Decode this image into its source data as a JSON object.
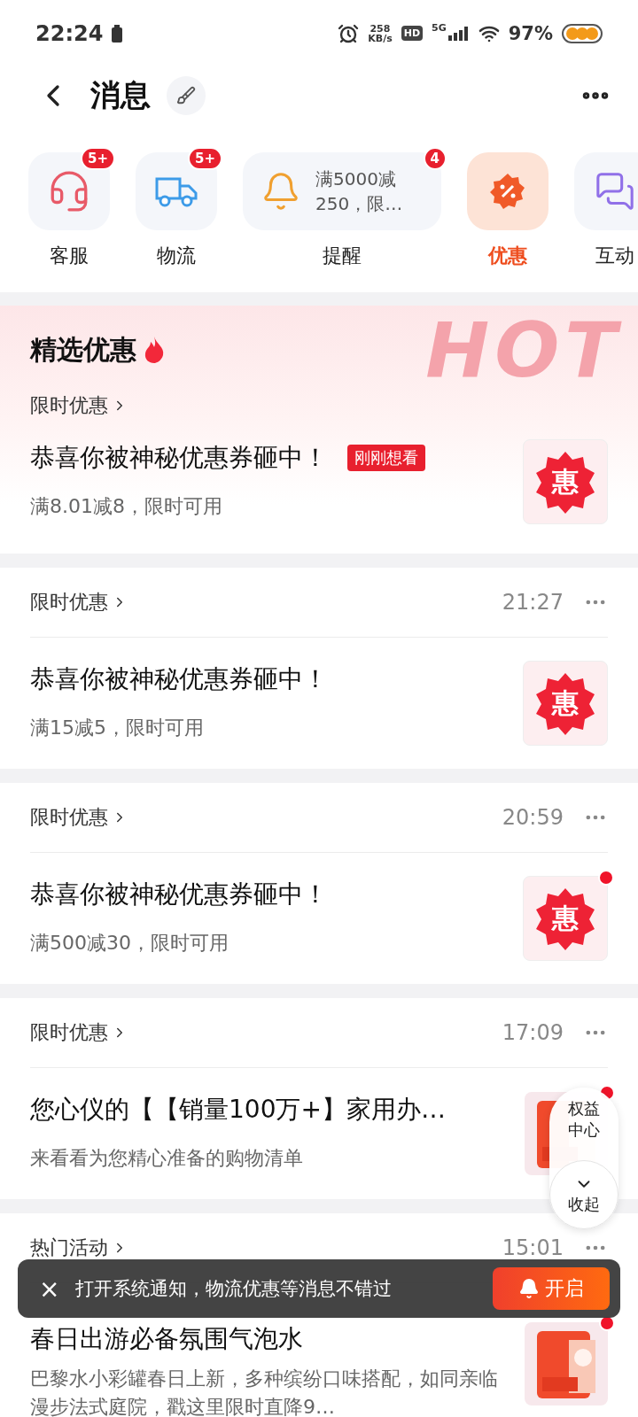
{
  "status_bar": {
    "time": "22:24",
    "speed_value": "258",
    "speed_unit": "KB/s",
    "hd": "HD",
    "network": "5G",
    "battery": "97%"
  },
  "header": {
    "title": "消息"
  },
  "categories": [
    {
      "kind": "icon",
      "label": "客服",
      "badge": "5+",
      "selected": false
    },
    {
      "kind": "icon",
      "label": "物流",
      "badge": "5+",
      "selected": false
    },
    {
      "kind": "preview",
      "label": "提醒",
      "badge": "4",
      "preview": "满5000减250，限…",
      "selected": false
    },
    {
      "kind": "icon",
      "label": "优惠",
      "selected": true
    },
    {
      "kind": "icon",
      "label": "互动",
      "selected": false
    }
  ],
  "featured": {
    "title": "精选优惠",
    "background_text": "HOT",
    "category": "限时优惠",
    "message": {
      "title": "恭喜你被神秘优惠券砸中！",
      "tag": "刚刚想看",
      "subtitle": "满8.01减8，限时可用",
      "kind": "coupon",
      "icon_text": "惠"
    }
  },
  "messages": [
    {
      "category": "限时优惠",
      "time": "21:27",
      "title": "恭喜你被神秘优惠券砸中！",
      "subtitle": "满15减5，限时可用",
      "kind": "coupon",
      "icon_text": "惠",
      "unread": false
    },
    {
      "category": "限时优惠",
      "time": "20:59",
      "title": "恭喜你被神秘优惠券砸中！",
      "subtitle": "满500减30，限时可用",
      "kind": "coupon",
      "icon_text": "惠",
      "unread": true
    },
    {
      "category": "限时优惠",
      "time": "17:09",
      "title": "您心仪的【【销量100万+】家用办…",
      "subtitle": "来看看为您精心准备的购物清单",
      "kind": "picture",
      "unread": true
    },
    {
      "category": "热门活动",
      "time": "15:01",
      "title": "春日出游必备氛围气泡水",
      "subtitle": "巴黎水小彩罐春日上新，多种缤纷口味搭配，如同亲临漫步法式庭院，戳这里限时直降9…",
      "kind": "picture",
      "unread": true
    }
  ],
  "floating": {
    "title": "权益中心",
    "collapse": "收起"
  },
  "toast": {
    "close": "×",
    "text": "打开系统通知，物流优惠等消息不错过",
    "button": "开启"
  }
}
